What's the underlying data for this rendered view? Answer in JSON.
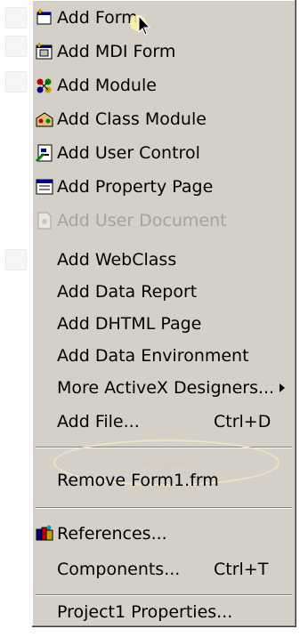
{
  "menu": {
    "items": [
      {
        "label": "Add Form",
        "shortcut": "",
        "icon": "form-icon"
      },
      {
        "label": "Add MDI Form",
        "shortcut": "",
        "icon": "mdi-form-icon"
      },
      {
        "label": "Add Module",
        "shortcut": "",
        "icon": "module-icon"
      },
      {
        "label": "Add Class Module",
        "shortcut": "",
        "icon": "class-module-icon"
      },
      {
        "label": "Add User Control",
        "shortcut": "",
        "icon": "user-control-icon"
      },
      {
        "label": "Add Property Page",
        "shortcut": "",
        "icon": "property-page-icon"
      },
      {
        "label": "Add User Document",
        "shortcut": "",
        "icon": "user-document-icon",
        "disabled": true
      },
      {
        "label": "Add WebClass",
        "shortcut": ""
      },
      {
        "label": "Add Data Report",
        "shortcut": ""
      },
      {
        "label": "Add DHTML Page",
        "shortcut": ""
      },
      {
        "label": "Add Data Environment",
        "shortcut": ""
      },
      {
        "label": "More ActiveX Designers...",
        "shortcut": "",
        "submenu": true
      },
      {
        "label": "Add File...",
        "shortcut": "Ctrl+D"
      },
      {
        "label": "Remove Form1.frm",
        "shortcut": ""
      },
      {
        "label": "References...",
        "shortcut": "",
        "icon": "references-icon"
      },
      {
        "label": "Components...",
        "shortcut": "Ctrl+T"
      },
      {
        "label": "Project1 Properties...",
        "shortcut": ""
      }
    ]
  },
  "watermark": {
    "text": "رميلي رنلد"
  },
  "colors": {
    "menu_bg": "#d4d0c8",
    "disabled_text": "#a6a39b"
  }
}
